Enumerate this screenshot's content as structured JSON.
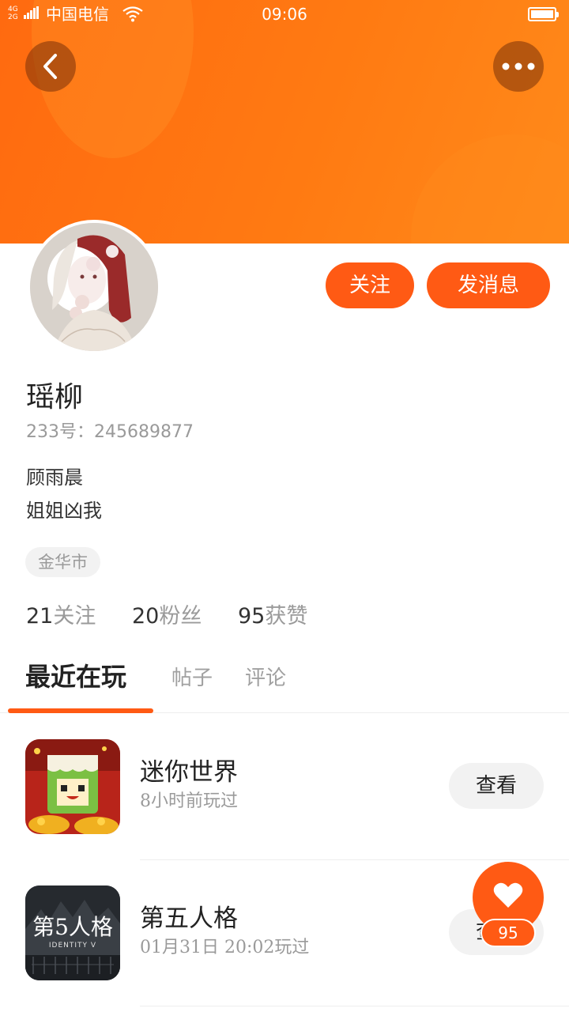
{
  "status_bar": {
    "network": "4G 2G",
    "carrier": "中国电信",
    "time": "09:06"
  },
  "header": {
    "back_icon": "chevron-left-icon",
    "more_icon": "more-horizontal-icon",
    "gradient_start": "#ff6a10",
    "gradient_end": "#ff8a1a"
  },
  "profile": {
    "nickname": "瑶柳",
    "uid": "233号：245689877",
    "bio_line1": "顾雨晨",
    "bio_line2": "姐姐凶我",
    "location": "金华市",
    "follow_label": "关注",
    "message_label": "发消息",
    "accent": "#ff5a14"
  },
  "stats": [
    {
      "num": "21",
      "label": "关注"
    },
    {
      "num": "20",
      "label": "粉丝"
    },
    {
      "num": "95",
      "label": "获赞"
    }
  ],
  "tabs": [
    {
      "label": "最近在玩",
      "active": true
    },
    {
      "label": "帖子",
      "active": false
    },
    {
      "label": "评论",
      "active": false
    }
  ],
  "games": [
    {
      "title": "迷你世界",
      "subtitle": "8小时前玩过",
      "button": "查看"
    },
    {
      "title": "第五人格",
      "subtitle": "01月31日  20:02玩过",
      "button": "查看",
      "icon_text": "第5人格",
      "icon_subtext": "IDENTITY V"
    }
  ],
  "like": {
    "icon": "heart-icon",
    "count": "95"
  }
}
